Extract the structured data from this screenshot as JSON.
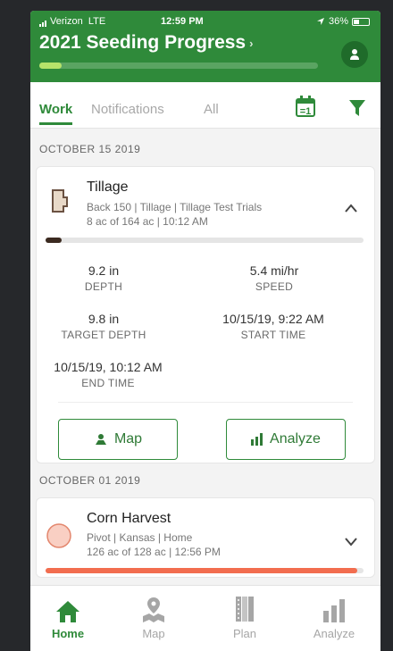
{
  "status_bar": {
    "carrier": "Verizon",
    "network": "LTE",
    "time": "12:59 PM",
    "battery": "36%"
  },
  "header": {
    "title": "2021 Seeding Progress",
    "progress_fraction": 0.08
  },
  "tabs": [
    {
      "label": "Work",
      "active": true
    },
    {
      "label": "Notifications",
      "active": false
    },
    {
      "label": "All",
      "active": false
    }
  ],
  "sections": [
    {
      "date": "OCTOBER 15 2019",
      "job": {
        "title": "Tillage",
        "details": "Back 150 | Tillage | Tillage Test Trials",
        "summary": "8 ac of 164 ac | 10:12 AM",
        "progress_fraction": 0.05,
        "progress_color": "#3b2a20",
        "metrics": [
          {
            "value": "9.2 in",
            "label": "DEPTH"
          },
          {
            "value": "5.4 mi/hr",
            "label": "SPEED"
          },
          {
            "value": "9.8 in",
            "label": "TARGET DEPTH"
          },
          {
            "value": "10/15/19, 9:22 AM",
            "label": "START TIME"
          },
          {
            "value": "10/15/19, 10:12 AM",
            "label": "END TIME"
          }
        ],
        "buttons": {
          "map": "Map",
          "analyze": "Analyze"
        }
      }
    },
    {
      "date": "OCTOBER 01 2019",
      "job": {
        "title": "Corn Harvest",
        "details": "Pivot | Kansas | Home",
        "summary": "126 ac of 128 ac | 12:56 PM",
        "progress_fraction": 0.98,
        "progress_color": "#f26d4f"
      }
    }
  ],
  "tabbar": [
    {
      "label": "Home",
      "active": true
    },
    {
      "label": "Map",
      "active": false
    },
    {
      "label": "Plan",
      "active": false
    },
    {
      "label": "Analyze",
      "active": false
    }
  ],
  "colors": {
    "brand_green": "#2f8a3a",
    "harvest_orange": "#f26d4f"
  }
}
